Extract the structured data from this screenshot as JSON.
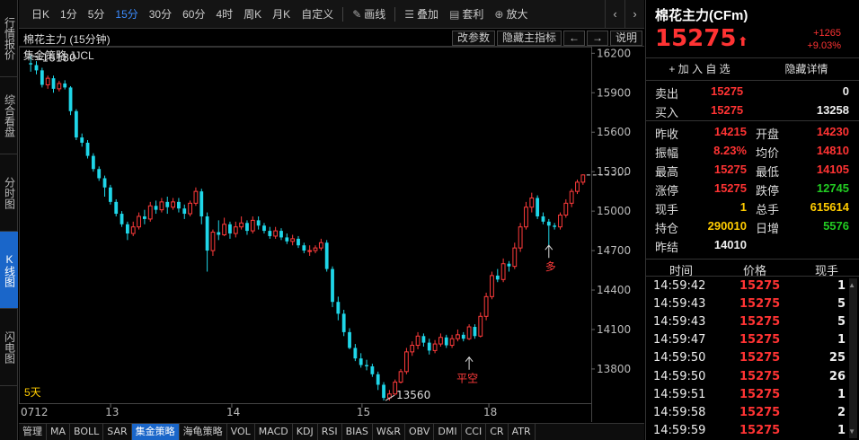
{
  "left_tabs": [
    {
      "label": "行情报价",
      "active": false
    },
    {
      "label": "综合看盘",
      "active": false
    },
    {
      "label": "分时图",
      "active": false
    },
    {
      "label": "K线图",
      "active": true
    },
    {
      "label": "闪电图",
      "active": false
    }
  ],
  "toolbar": {
    "periods": [
      {
        "label": "日K",
        "active": false
      },
      {
        "label": "1分",
        "active": false
      },
      {
        "label": "5分",
        "active": false
      },
      {
        "label": "15分",
        "active": true
      },
      {
        "label": "30分",
        "active": false
      },
      {
        "label": "60分",
        "active": false
      },
      {
        "label": "4时",
        "active": false
      },
      {
        "label": "周K",
        "active": false
      },
      {
        "label": "月K",
        "active": false
      },
      {
        "label": "自定义",
        "active": false
      }
    ],
    "draw_label": "画线",
    "overlay_label": "叠加",
    "arbitrage_label": "套利",
    "zoom_label": "放大"
  },
  "chart_header": {
    "title": "棉花主力 (15分钟)",
    "buttons": [
      "改参数",
      "隐藏主指标",
      "←",
      "→",
      "说明"
    ]
  },
  "strategy_label": "集金策略 JJCL",
  "chart_data": {
    "type": "candlestick",
    "symbol": "棉花主力",
    "period": "15分钟",
    "y_ticks": [
      16200,
      15900,
      15600,
      15300,
      15000,
      14700,
      14400,
      14100,
      13800
    ],
    "x_ticks": [
      "0712",
      "13",
      "14",
      "15",
      "18"
    ],
    "annotations": [
      {
        "text": "16180",
        "value": 16180
      },
      {
        "text": "13560",
        "value": 13560
      },
      {
        "text": "平空",
        "value": 13890
      },
      {
        "text": "多",
        "value": 14740
      }
    ],
    "range_label": "5天",
    "ylim": [
      13540,
      16250
    ],
    "candles": [
      [
        16125,
        16115,
        16180,
        16060
      ],
      [
        16110,
        16070,
        16140,
        16040
      ],
      [
        16070,
        15960,
        16090,
        15940
      ],
      [
        15960,
        16010,
        16030,
        15930
      ],
      [
        16010,
        15930,
        16030,
        15900
      ],
      [
        15930,
        15970,
        15990,
        15910
      ],
      [
        15970,
        15940,
        15995,
        15925
      ],
      [
        15940,
        15760,
        15950,
        15730
      ],
      [
        15760,
        15560,
        15775,
        15540
      ],
      [
        15560,
        15520,
        15590,
        15490
      ],
      [
        15520,
        15420,
        15540,
        15400
      ],
      [
        15420,
        15320,
        15440,
        15300
      ],
      [
        15320,
        15250,
        15340,
        15230
      ],
      [
        15250,
        15180,
        15270,
        15110
      ],
      [
        15180,
        15070,
        15200,
        15050
      ],
      [
        15070,
        14980,
        15090,
        14960
      ],
      [
        14980,
        14900,
        15000,
        14880
      ],
      [
        14900,
        14830,
        14920,
        14780
      ],
      [
        14830,
        14880,
        14920,
        14810
      ],
      [
        14880,
        14960,
        14990,
        14860
      ],
      [
        14960,
        14940,
        15010,
        14900
      ],
      [
        14940,
        15040,
        15070,
        14920
      ],
      [
        15040,
        15010,
        15080,
        14980
      ],
      [
        15010,
        15070,
        15100,
        14990
      ],
      [
        15070,
        15030,
        15110,
        14980
      ],
      [
        15030,
        15070,
        15100,
        15010
      ],
      [
        15070,
        15020,
        15100,
        14990
      ],
      [
        15020,
        14980,
        15050,
        14940
      ],
      [
        14980,
        15060,
        15080,
        14960
      ],
      [
        15060,
        15150,
        15180,
        15040
      ],
      [
        15150,
        14960,
        15170,
        14900
      ],
      [
        14960,
        14700,
        14990,
        14540
      ],
      [
        14700,
        14840,
        14860,
        14660
      ],
      [
        14840,
        14820,
        14930,
        14780
      ],
      [
        14820,
        14900,
        14950,
        14810
      ],
      [
        14900,
        14830,
        14920,
        14790
      ],
      [
        14830,
        14880,
        14920,
        14800
      ],
      [
        14880,
        14910,
        14960,
        14860
      ],
      [
        14910,
        14850,
        14930,
        14820
      ],
      [
        14850,
        14930,
        14960,
        14830
      ],
      [
        14930,
        14890,
        14960,
        14860
      ],
      [
        14890,
        14850,
        14910,
        14830
      ],
      [
        14850,
        14810,
        14880,
        14790
      ],
      [
        14810,
        14850,
        14880,
        14790
      ],
      [
        14850,
        14800,
        14870,
        14780
      ],
      [
        14800,
        14770,
        14830,
        14750
      ],
      [
        14770,
        14790,
        14820,
        14740
      ],
      [
        14790,
        14740,
        14810,
        14720
      ],
      [
        14740,
        14700,
        14760,
        14680
      ],
      [
        14700,
        14700,
        14740,
        14660
      ],
      [
        14700,
        14720,
        14740,
        14680
      ],
      [
        14720,
        14760,
        14790,
        14700
      ],
      [
        14760,
        14560,
        14780,
        14540
      ],
      [
        14560,
        14310,
        14580,
        14270
      ],
      [
        14310,
        14220,
        14350,
        14170
      ],
      [
        14220,
        14080,
        14250,
        14050
      ],
      [
        14080,
        13960,
        14110,
        13950
      ],
      [
        13960,
        13880,
        13990,
        13860
      ],
      [
        13880,
        13830,
        13920,
        13810
      ],
      [
        13830,
        13820,
        13870,
        13790
      ],
      [
        13820,
        13760,
        13840,
        13740
      ],
      [
        13760,
        13680,
        13780,
        13640
      ],
      [
        13680,
        13580,
        13700,
        13560
      ],
      [
        13580,
        13610,
        13640,
        13560
      ],
      [
        13610,
        13700,
        13720,
        13600
      ],
      [
        13700,
        13780,
        13800,
        13690
      ],
      [
        13780,
        13930,
        13960,
        13760
      ],
      [
        13930,
        13980,
        14010,
        13900
      ],
      [
        13980,
        14050,
        14080,
        13950
      ],
      [
        14050,
        14000,
        14070,
        13970
      ],
      [
        14000,
        13940,
        14030,
        13910
      ],
      [
        13940,
        13990,
        14020,
        13920
      ],
      [
        13990,
        14040,
        14070,
        13970
      ],
      [
        14040,
        13980,
        14060,
        13960
      ],
      [
        13980,
        14030,
        14060,
        13960
      ],
      [
        14030,
        14060,
        14100,
        14010
      ],
      [
        14060,
        14030,
        14080,
        14010
      ],
      [
        14030,
        14120,
        14140,
        14020
      ],
      [
        14120,
        14050,
        14140,
        14030
      ],
      [
        14050,
        14200,
        14230,
        14040
      ],
      [
        14200,
        14350,
        14380,
        14170
      ],
      [
        14350,
        14510,
        14540,
        14330
      ],
      [
        14510,
        14480,
        14560,
        14460
      ],
      [
        14480,
        14600,
        14640,
        14460
      ],
      [
        14600,
        14580,
        14620,
        14540
      ],
      [
        14580,
        14720,
        14760,
        14560
      ],
      [
        14720,
        14880,
        14910,
        14690
      ],
      [
        14880,
        15030,
        15070,
        14860
      ],
      [
        15030,
        15100,
        15140,
        14990
      ],
      [
        15100,
        14960,
        15120,
        14940
      ],
      [
        14960,
        14920,
        14990,
        14900
      ],
      [
        14920,
        14890,
        14940,
        14740
      ],
      [
        14890,
        14880,
        14910,
        14860
      ],
      [
        14880,
        14970,
        14990,
        14860
      ],
      [
        14970,
        15060,
        15090,
        14950
      ],
      [
        15060,
        15150,
        15170,
        15030
      ],
      [
        15150,
        15220,
        15240,
        15130
      ],
      [
        15220,
        15275,
        15280,
        15200
      ]
    ],
    "last_price": 15275
  },
  "indicator_tabs": [
    {
      "label": "管理",
      "active": false
    },
    {
      "label": "MA",
      "active": false
    },
    {
      "label": "BOLL",
      "active": false
    },
    {
      "label": "SAR",
      "active": false
    },
    {
      "label": "集金策略",
      "active": true
    },
    {
      "label": "海龟策略",
      "active": false
    },
    {
      "label": "VOL",
      "active": false
    },
    {
      "label": "MACD",
      "active": false
    },
    {
      "label": "KDJ",
      "active": false
    },
    {
      "label": "RSI",
      "active": false
    },
    {
      "label": "BIAS",
      "active": false
    },
    {
      "label": "W&R",
      "active": false
    },
    {
      "label": "OBV",
      "active": false
    },
    {
      "label": "DMI",
      "active": false
    },
    {
      "label": "CCI",
      "active": false
    },
    {
      "label": "CR",
      "active": false
    },
    {
      "label": "ATR",
      "active": false
    }
  ],
  "quote": {
    "name": "棉花主力(CFm)",
    "price": "15275",
    "change": "+1265",
    "change_pct": "+9.03%",
    "add_watch": "+ 加 入 自 选",
    "hide_detail": "隐藏详情",
    "sell_label": "卖出",
    "sell_price": "15275",
    "sell_vol": "0",
    "buy_label": "买入",
    "buy_price": "15275",
    "buy_vol": "13258",
    "stats": [
      {
        "l1": "昨收",
        "v1": "14215",
        "c1": "red",
        "l2": "开盘",
        "v2": "14230",
        "c2": "red"
      },
      {
        "l1": "振幅",
        "v1": "8.23%",
        "c1": "red",
        "l2": "均价",
        "v2": "14810",
        "c2": "red"
      },
      {
        "l1": "最高",
        "v1": "15275",
        "c1": "red",
        "l2": "最低",
        "v2": "14105",
        "c2": "red"
      },
      {
        "l1": "涨停",
        "v1": "15275",
        "c1": "red",
        "l2": "跌停",
        "v2": "12745",
        "c2": "green"
      },
      {
        "l1": "现手",
        "v1": "1",
        "c1": "yellow",
        "l2": "总手",
        "v2": "615614",
        "c2": "yellow"
      },
      {
        "l1": "持仓",
        "v1": "290010",
        "c1": "yellow",
        "l2": "日增",
        "v2": "5576",
        "c2": "green"
      },
      {
        "l1": "昨结",
        "v1": "14010",
        "c1": "white",
        "l2": "",
        "v2": "",
        "c2": "white"
      }
    ],
    "tick_headers": [
      "时间",
      "价格",
      "现手"
    ],
    "ticks": [
      {
        "time": "14:59:42",
        "price": "15275",
        "vol": "1"
      },
      {
        "time": "14:59:43",
        "price": "15275",
        "vol": "5"
      },
      {
        "time": "14:59:43",
        "price": "15275",
        "vol": "5"
      },
      {
        "time": "14:59:47",
        "price": "15275",
        "vol": "1"
      },
      {
        "time": "14:59:50",
        "price": "15275",
        "vol": "25"
      },
      {
        "time": "14:59:50",
        "price": "15275",
        "vol": "26"
      },
      {
        "time": "14:59:51",
        "price": "15275",
        "vol": "1"
      },
      {
        "time": "14:59:58",
        "price": "15275",
        "vol": "2"
      },
      {
        "time": "14:59:59",
        "price": "15275",
        "vol": "1"
      }
    ]
  }
}
